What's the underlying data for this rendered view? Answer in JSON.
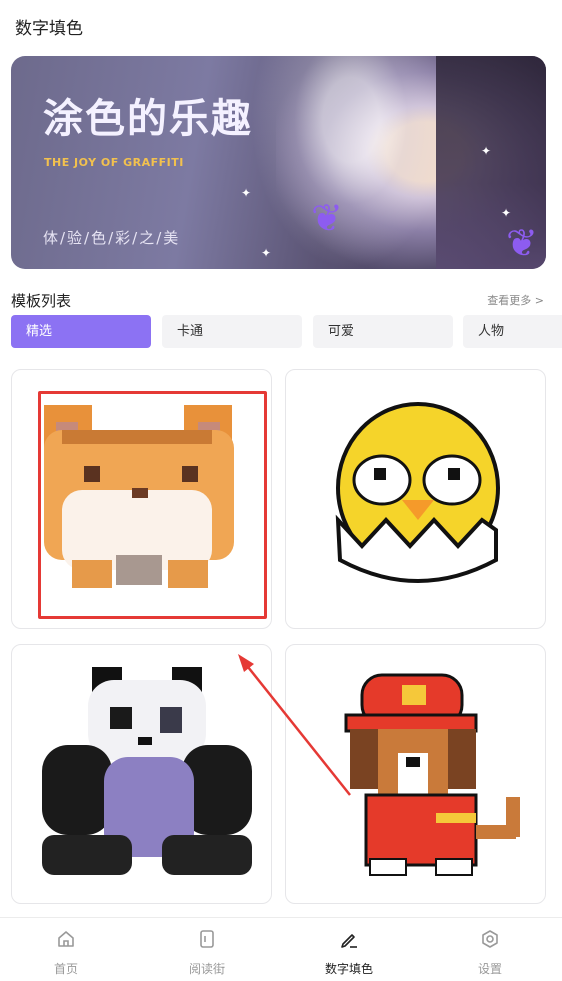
{
  "app": {
    "title": "数字填色"
  },
  "banner": {
    "title": "涂色的乐趣",
    "subtitle": "THE JOY OF GRAFFITI",
    "footer": "体/验/色/彩/之/美"
  },
  "templates": {
    "section_title": "模板列表",
    "more_label": "查看更多 >",
    "tabs": [
      {
        "label": "精选",
        "active": true
      },
      {
        "label": "卡通",
        "active": false
      },
      {
        "label": "可爱",
        "active": false
      },
      {
        "label": "人物",
        "active": false
      }
    ],
    "cards": [
      {
        "subject": "pixel-cat"
      },
      {
        "subject": "pixel-chick"
      },
      {
        "subject": "pixel-panda"
      },
      {
        "subject": "pixel-firefighter-dog"
      }
    ]
  },
  "nav": {
    "items": [
      {
        "label": "首页",
        "icon": "home-icon",
        "active": false
      },
      {
        "label": "阅读街",
        "icon": "book-icon",
        "active": false
      },
      {
        "label": "数字填色",
        "icon": "pen-icon",
        "active": true
      },
      {
        "label": "设置",
        "icon": "settings-icon",
        "active": false
      }
    ]
  },
  "colors": {
    "accent": "#8c72f3",
    "annotation": "#e53935"
  }
}
